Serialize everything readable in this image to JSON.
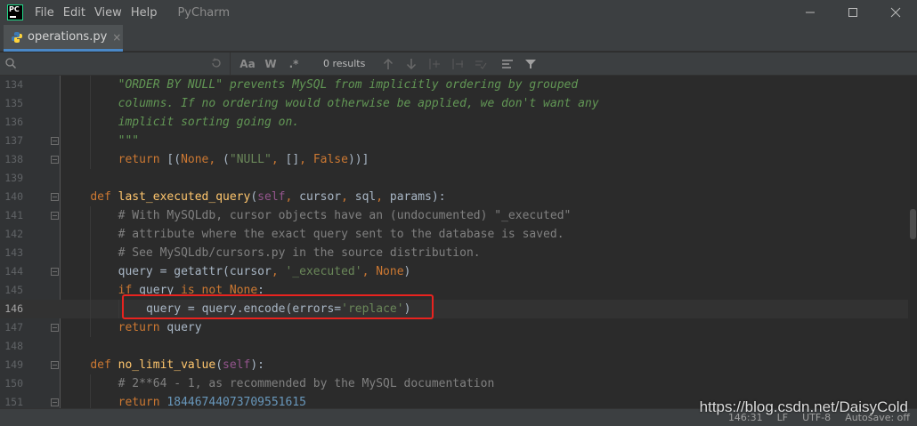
{
  "app": {
    "name": "PyCharm",
    "menu": [
      "File",
      "Edit",
      "View",
      "Help"
    ]
  },
  "tab": {
    "label": "operations.py",
    "close": "×"
  },
  "search": {
    "placeholder": "",
    "options": [
      "Aa",
      "W",
      ".*"
    ],
    "results": "0 results"
  },
  "colors": {
    "highlight_box": "#e8231f",
    "tab_accent": "#4a88c7"
  },
  "editor": {
    "current_line": "146",
    "lines": [
      {
        "n": "134",
        "indent": 8,
        "tokens": [
          {
            "c": "doc",
            "t": "\"ORDER BY NULL\" prevents MySQL from implicitly ordering by grouped"
          }
        ]
      },
      {
        "n": "135",
        "indent": 8,
        "tokens": [
          {
            "c": "doc",
            "t": "columns. If no ordering would otherwise be applied, we don't want any"
          }
        ]
      },
      {
        "n": "136",
        "indent": 8,
        "tokens": [
          {
            "c": "doc",
            "t": "implicit sorting going on."
          }
        ]
      },
      {
        "n": "137",
        "indent": 8,
        "fold": true,
        "tokens": [
          {
            "c": "doc",
            "t": "\"\"\""
          }
        ]
      },
      {
        "n": "138",
        "indent": 8,
        "fold": true,
        "tokens": [
          {
            "c": "kw",
            "t": "return "
          },
          {
            "c": "txt",
            "t": "[("
          },
          {
            "c": "kw",
            "t": "None"
          },
          {
            "c": "kw",
            "t": ", "
          },
          {
            "c": "txt",
            "t": "("
          },
          {
            "c": "str",
            "t": "\"NULL\""
          },
          {
            "c": "kw",
            "t": ", "
          },
          {
            "c": "txt",
            "t": "[]"
          },
          {
            "c": "kw",
            "t": ", "
          },
          {
            "c": "kw",
            "t": "False"
          },
          {
            "c": "txt",
            "t": "))]"
          }
        ]
      },
      {
        "n": "139",
        "indent": 0,
        "tokens": []
      },
      {
        "n": "140",
        "indent": 4,
        "fold": true,
        "tokens": [
          {
            "c": "kw",
            "t": "def "
          },
          {
            "c": "fn",
            "t": "last_executed_query"
          },
          {
            "c": "txt",
            "t": "("
          },
          {
            "c": "sl",
            "t": "self"
          },
          {
            "c": "kw",
            "t": ", "
          },
          {
            "c": "txt",
            "t": "cursor"
          },
          {
            "c": "kw",
            "t": ", "
          },
          {
            "c": "txt",
            "t": "sql"
          },
          {
            "c": "kw",
            "t": ", "
          },
          {
            "c": "txt",
            "t": "params):"
          }
        ]
      },
      {
        "n": "141",
        "indent": 8,
        "fold": true,
        "tokens": [
          {
            "c": "cmt",
            "t": "# With MySQLdb, cursor objects have an (undocumented) \"_executed\""
          }
        ]
      },
      {
        "n": "142",
        "indent": 8,
        "tokens": [
          {
            "c": "cmt",
            "t": "# attribute where the exact query sent to the database is saved."
          }
        ]
      },
      {
        "n": "143",
        "indent": 8,
        "tokens": [
          {
            "c": "cmt",
            "t": "# See MySQLdb/cursors.py in the source distribution."
          }
        ]
      },
      {
        "n": "144",
        "indent": 8,
        "fold": true,
        "tokens": [
          {
            "c": "txt",
            "t": "query = getattr(cursor"
          },
          {
            "c": "kw",
            "t": ", "
          },
          {
            "c": "str",
            "t": "'_executed'"
          },
          {
            "c": "kw",
            "t": ", "
          },
          {
            "c": "kw",
            "t": "None"
          },
          {
            "c": "txt",
            "t": ")"
          }
        ]
      },
      {
        "n": "145",
        "indent": 8,
        "tokens": [
          {
            "c": "kw",
            "t": "if "
          },
          {
            "c": "txt",
            "t": "query "
          },
          {
            "c": "kw",
            "t": "is not None"
          },
          {
            "c": "txt",
            "t": ":"
          }
        ]
      },
      {
        "n": "146",
        "indent": 12,
        "tokens": [
          {
            "c": "txt",
            "t": "query = query.encode("
          },
          {
            "c": "txt",
            "t": "errors="
          },
          {
            "c": "str",
            "t": "'replace'"
          },
          {
            "c": "txt",
            "t": ")"
          }
        ]
      },
      {
        "n": "147",
        "indent": 8,
        "fold": true,
        "tokens": [
          {
            "c": "kw",
            "t": "return "
          },
          {
            "c": "txt",
            "t": "query"
          }
        ]
      },
      {
        "n": "148",
        "indent": 0,
        "tokens": []
      },
      {
        "n": "149",
        "indent": 4,
        "fold": true,
        "tokens": [
          {
            "c": "kw",
            "t": "def "
          },
          {
            "c": "fn",
            "t": "no_limit_value"
          },
          {
            "c": "txt",
            "t": "("
          },
          {
            "c": "sl",
            "t": "self"
          },
          {
            "c": "txt",
            "t": "):"
          }
        ]
      },
      {
        "n": "150",
        "indent": 8,
        "tokens": [
          {
            "c": "cmt",
            "t": "# 2**64 - 1, as recommended by the MySQL documentation"
          }
        ]
      },
      {
        "n": "151",
        "indent": 8,
        "fold": true,
        "tokens": [
          {
            "c": "kw",
            "t": "return "
          },
          {
            "c": "num",
            "t": "18446744073709551615"
          }
        ]
      }
    ]
  },
  "status": {
    "position": "146:31",
    "line_sep": "LF",
    "encoding": "UTF-8",
    "autosave": "Autosave: off"
  },
  "watermark": "https://blog.csdn.net/DaisyCold"
}
